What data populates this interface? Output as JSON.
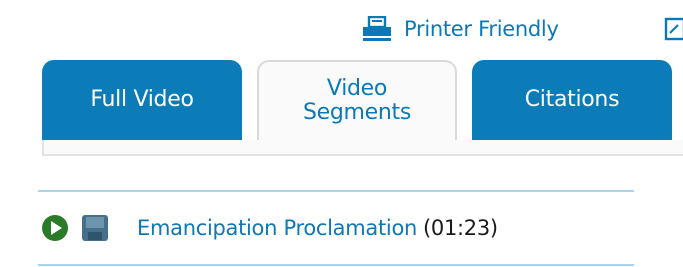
{
  "toolbar": {
    "printer_label": "Printer Friendly",
    "printer_icon": "printer-icon",
    "extra_icon": "share-icon"
  },
  "tabs": [
    {
      "label_line1": "Full Video",
      "label_line2": "",
      "active": false
    },
    {
      "label_line1": "Video",
      "label_line2": "Segments",
      "active": true
    },
    {
      "label_line1": "Citations",
      "label_line2": "",
      "active": false
    }
  ],
  "segments": [
    {
      "title": "Emancipation Proclamation",
      "duration": "(01:23)",
      "play_icon": "play-icon",
      "save_icon": "save-icon"
    }
  ],
  "colors": {
    "link": "#0c79b6",
    "tab_active_bg": "#fafafa",
    "tab_inactive_bg": "#0c7cb8",
    "play_icon": "#2a7a2a",
    "save_icon": "#44708c"
  }
}
